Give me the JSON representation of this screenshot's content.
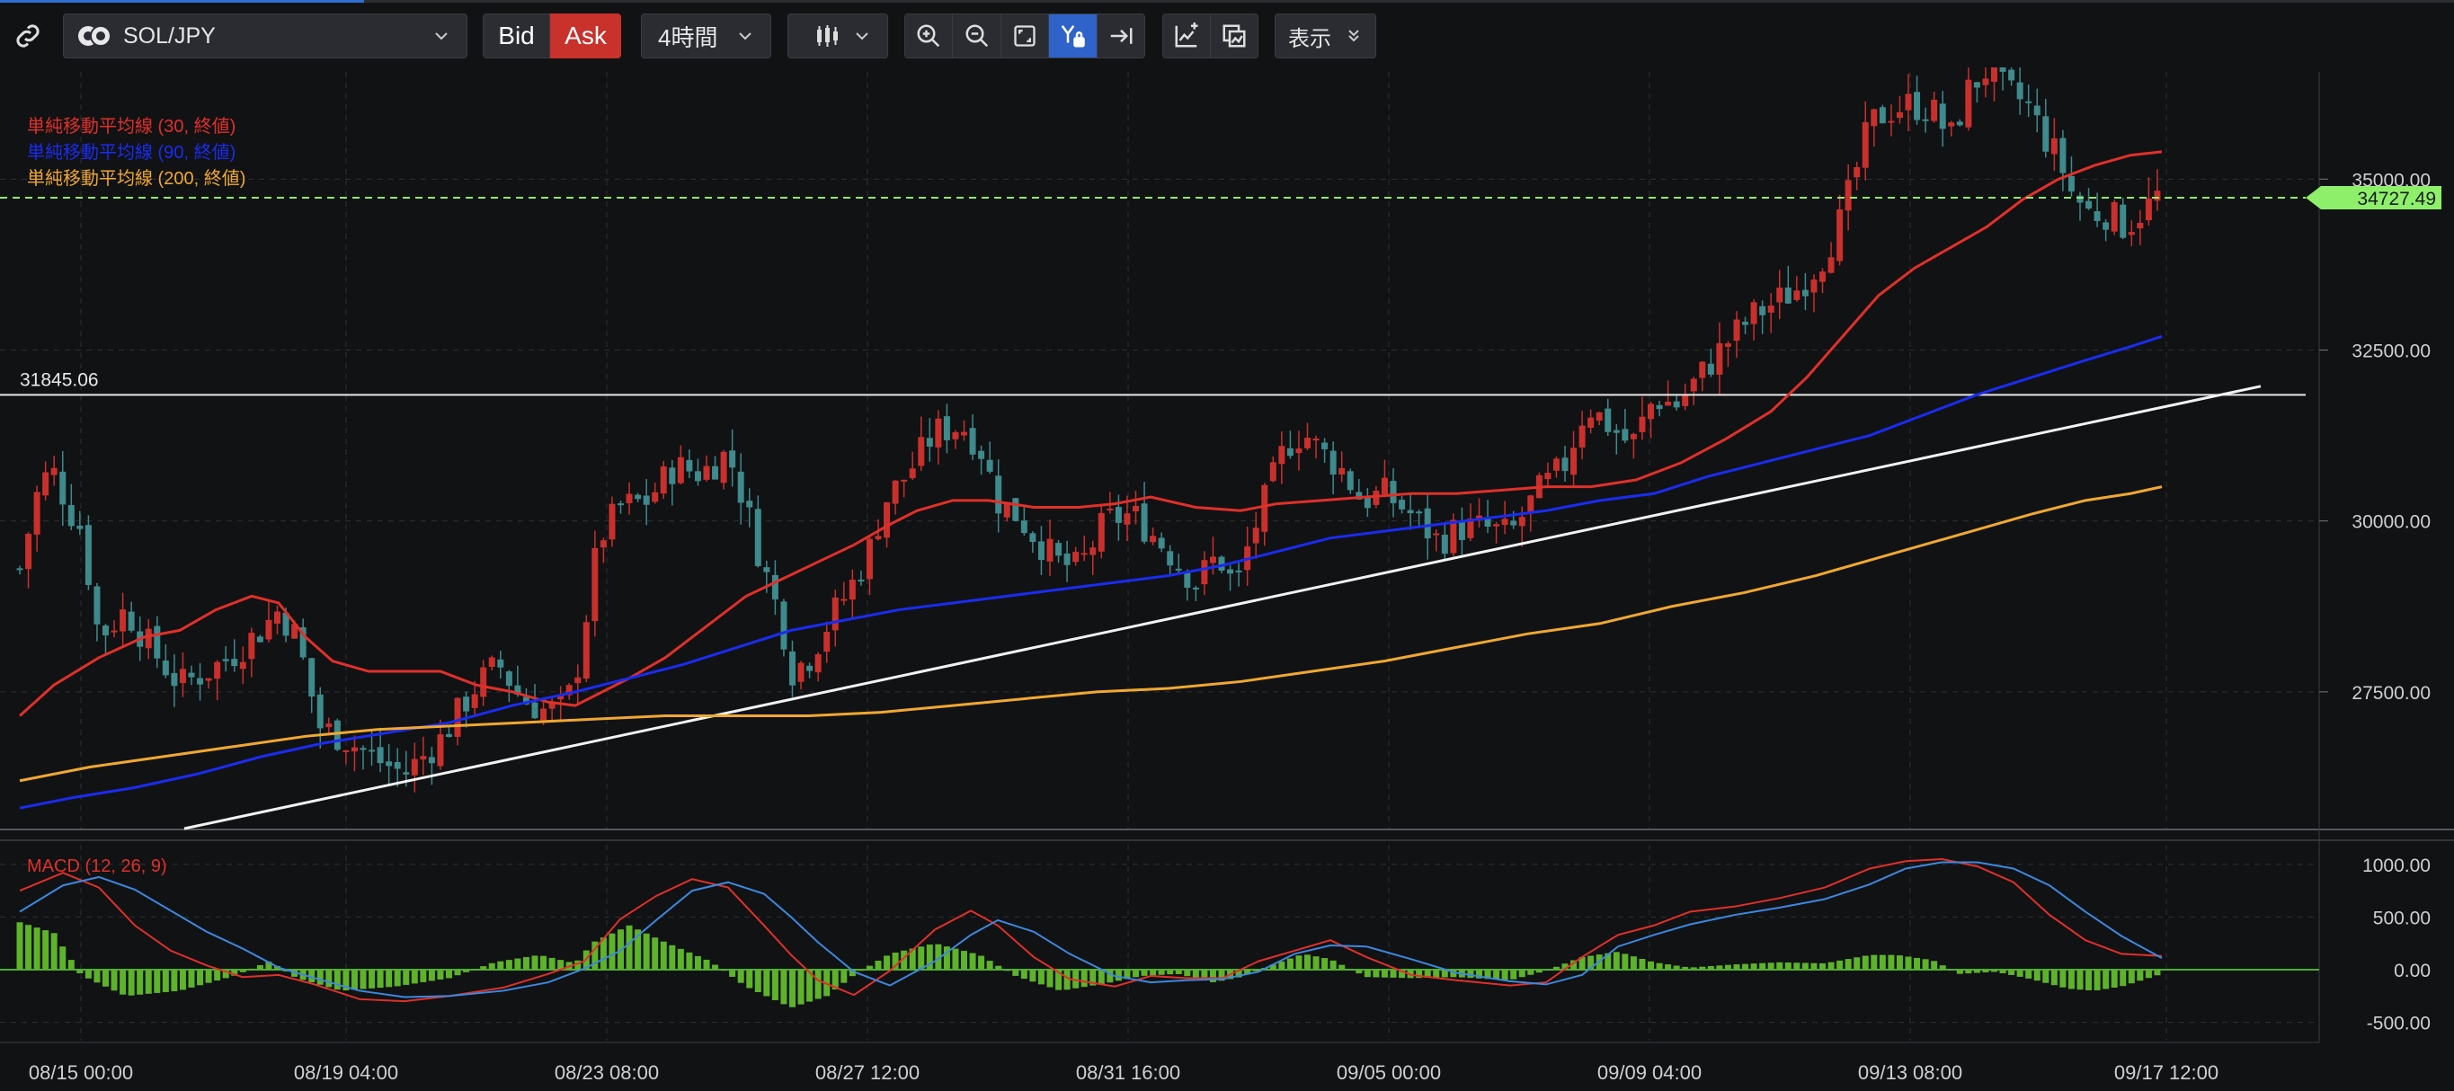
{
  "toolbar": {
    "symbol": "SOL/JPY",
    "bid_label": "Bid",
    "ask_label": "Ask",
    "timeframe": "4時間",
    "view_label": "表示"
  },
  "chart_data": {
    "type": "line",
    "price_ticks": [
      "35000.00",
      "32500.00",
      "30000.00",
      "27500.00"
    ],
    "price_ylim": [
      25500,
      36700
    ],
    "current_price": "34727.49",
    "horizontal_line_label": "31845.06",
    "x_ticks": [
      "08/15 00:00",
      "08/19 04:00",
      "08/23 08:00",
      "08/27 12:00",
      "08/31 16:00",
      "09/05 00:00",
      "09/09 04:00",
      "09/13 08:00",
      "09/17 12:00"
    ],
    "legend": [
      {
        "text": "単純移動平均線 (30, 終値)",
        "color": "#e0302a"
      },
      {
        "text": "単純移動平均線 (90, 終値)",
        "color": "#1a2cf0"
      },
      {
        "text": "単純移動平均線 (200, 終値)",
        "color": "#f0a830"
      }
    ],
    "macd_label": "MACD (12, 26, 9)",
    "macd_ticks": [
      "1000.00",
      "500.00",
      "0.00",
      "-500.00"
    ],
    "macd_ylim": [
      -650,
      1100
    ],
    "colors": {
      "up": "#c9302c",
      "down": "#3e8a8c",
      "hist": "#5db32a",
      "macd": "#e0302a",
      "signal": "#3c88e0",
      "current": "#8ef06a"
    }
  }
}
